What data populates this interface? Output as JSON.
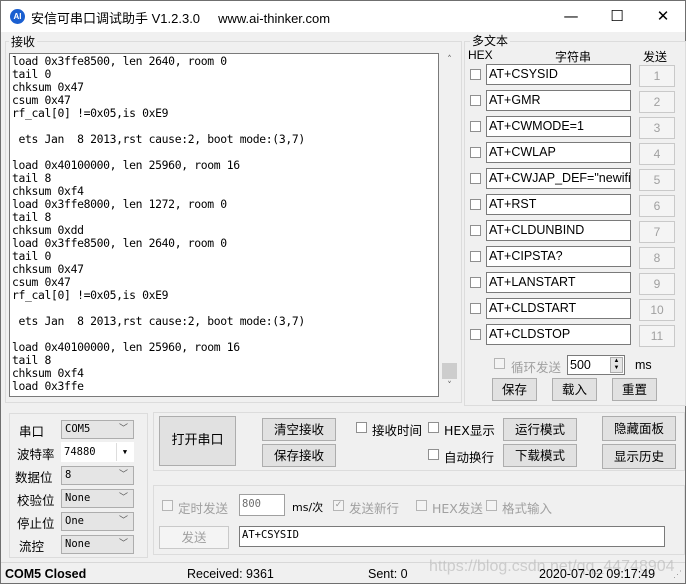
{
  "window": {
    "title": "安信可串口调试助手 V1.2.3.0     www.ai-thinker.com",
    "icon_text": "AI",
    "minimize_glyph": "—",
    "maximize_glyph": "☐",
    "close_glyph": "✕"
  },
  "receive": {
    "label": "接收",
    "lines": "load 0x3ffe8500, len 2640, room 0\ntail 0\nchksum 0x47\ncsum 0x47\nrf_cal[0] !=0x05,is 0xE9\n\n ets Jan  8 2013,rst cause:2, boot mode:(3,7)\n\nload 0x40100000, len 25960, room 16\ntail 8\nchksum 0xf4\nload 0x3ffe8000, len 1272, room 0\ntail 8\nchksum 0xdd\nload 0x3ffe8500, len 2640, room 0\ntail 0\nchksum 0x47\ncsum 0x47\nrf_cal[0] !=0x05,is 0xE9\n\n ets Jan  8 2013,rst cause:2, boot mode:(3,7)\n\nload 0x40100000, len 25960, room 16\ntail 8\nchksum 0xf4\nload 0x3ffe",
    "scroll_up": "˄",
    "scroll_down": "˅"
  },
  "multitext": {
    "label": "多文本",
    "col_hex": "HEX",
    "col_string": "字符串",
    "col_send": "发送",
    "rows": [
      {
        "text": "AT+CSYSID",
        "button": "1",
        "hex": false
      },
      {
        "text": "AT+GMR",
        "button": "2",
        "hex": false
      },
      {
        "text": "AT+CWMODE=1",
        "button": "3",
        "hex": false
      },
      {
        "text": "AT+CWLAP",
        "button": "4",
        "hex": false
      },
      {
        "text": "AT+CWJAP_DEF=\"newifi_",
        "button": "5",
        "hex": false
      },
      {
        "text": "AT+RST",
        "button": "6",
        "hex": false
      },
      {
        "text": "AT+CLDUNBIND",
        "button": "7",
        "hex": false
      },
      {
        "text": "AT+CIPSTA?",
        "button": "8",
        "hex": false
      },
      {
        "text": "AT+LANSTART",
        "button": "9",
        "hex": false
      },
      {
        "text": "AT+CLDSTART",
        "button": "10",
        "hex": false
      },
      {
        "text": "AT+CLDSTOP",
        "button": "11",
        "hex": false
      }
    ],
    "loop_send_label": "循环发送",
    "loop_interval": "500",
    "loop_unit": "ms",
    "save": "保存",
    "load": "载入",
    "reset": "重置"
  },
  "serial": {
    "port_label": "串口",
    "port_value": "COM5",
    "baud_label": "波特率",
    "baud_value": "74880",
    "databits_label": "数据位",
    "databits_value": "8",
    "parity_label": "校验位",
    "parity_value": "None",
    "stopbits_label": "停止位",
    "stopbits_value": "One",
    "flow_label": "流控",
    "flow_value": "None",
    "open_button": "打开串口"
  },
  "controls": {
    "clear_receive": "清空接收",
    "save_receive": "保存接收",
    "receive_time": "接收时间",
    "hex_display": "HEX显示",
    "auto_newline": "自动换行",
    "run_mode": "运行模式",
    "download_mode": "下载模式",
    "hide_panel": "隐藏面板",
    "show_history": "显示历史"
  },
  "send": {
    "timed_send": "定时发送",
    "interval": "800",
    "interval_unit": "ms/次",
    "send_newline": "发送新行",
    "hex_send": "HEX发送",
    "format_input": "格式输入",
    "send_button": "发送",
    "input_value": "AT+CSYSID"
  },
  "statusbar": {
    "port_state": "COM5 Closed",
    "received": "Received: 9361",
    "sent": "Sent: 0",
    "datetime": "2020-07-02 09:17:49"
  },
  "watermark": "https://blog.csdn.net/qq_44748904"
}
